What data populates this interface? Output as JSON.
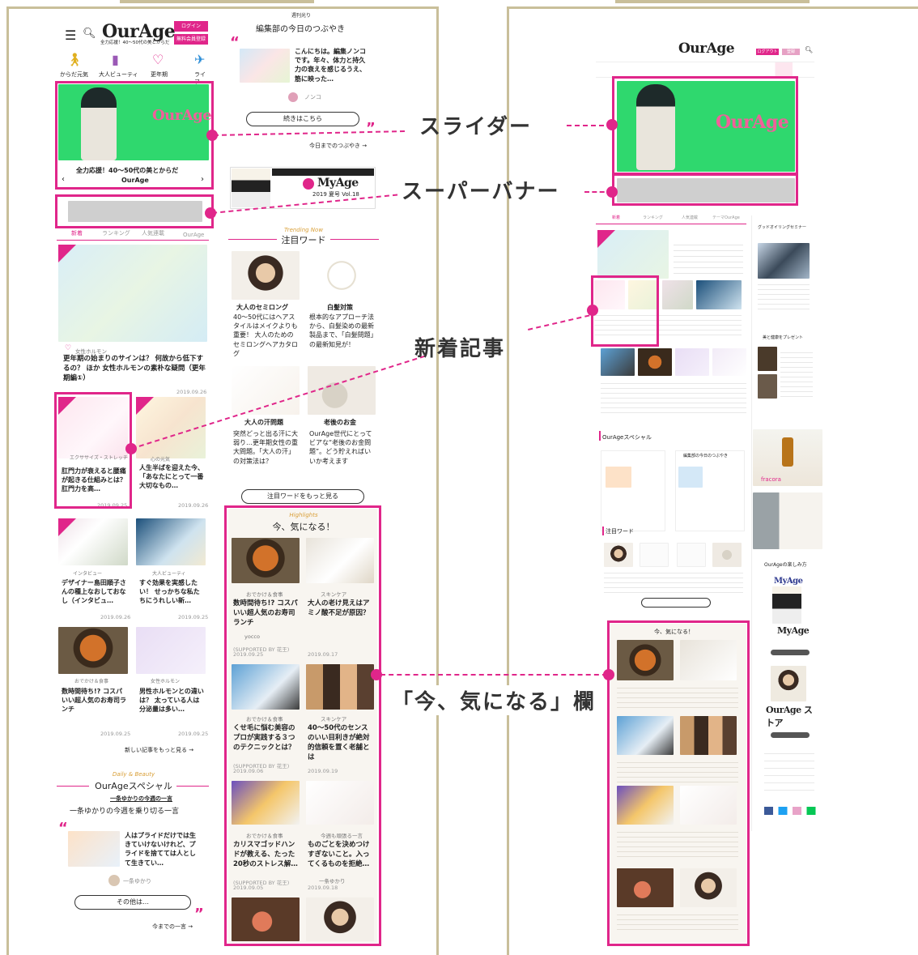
{
  "callouts": {
    "slider": "スライダー",
    "super_banner": "スーパーバナー",
    "new_articles": "新着記事",
    "ima_ki_ni_naru": "「今、気になる」欄"
  },
  "mobile": {
    "logo": "OurAge",
    "tagline": "全力応援！40〜50代の美とからだ",
    "login": "ログイン",
    "register": "無料会員登録",
    "categories": [
      {
        "label": "からだ元気",
        "icon": "figure-icon"
      },
      {
        "label": "大人ビューティ",
        "icon": "lipstick-icon"
      },
      {
        "label": "更年期",
        "icon": "heart-icon"
      },
      {
        "label": "ライフ",
        "icon": "paper-plane-icon"
      }
    ],
    "slider_logo": "OurAge",
    "slider_caption_1": "全力応援！40〜50代の美とからだ",
    "slider_caption_2": "OurAge",
    "tabs": [
      "新着",
      "ランキング",
      "人気連載",
      "OurAge"
    ],
    "articles": [
      {
        "cat": "女性ホルモン",
        "title": "更年期の始まりのサインは？ 何故から低下するの？ ほか 女性ホルモンの素朴な疑問（更年期編①）",
        "date": "2019.09.26"
      },
      {
        "cat": "エクササイズ・ストレッチ",
        "title": "肛門力が衰えると腰痛が起きる仕組みとは？ 肛門力を高…",
        "date": "2019.09.25"
      },
      {
        "cat": "心の元気",
        "title": "人生半ばを迎えた今、「あなたにとって一番大切なもの…",
        "date": "2019.09.26"
      },
      {
        "cat": "インタビュー",
        "title": "デザイナー島田順子さんの種上なおしておなし（インタビュ…",
        "date": "2019.09.26"
      },
      {
        "cat": "大人ビューティ",
        "title": "すぐ効果を実感したい！ せっかちな私たちにうれしい新…",
        "date": "2019.09.25"
      },
      {
        "cat": "おでかけ＆食事",
        "title": "数時間待ち!? コスパいい超人気のお寿司ランチ",
        "date": "2019.09.25"
      },
      {
        "cat": "女性ホルモン",
        "title": "男性ホルモンとの違いは？ 太っている人は分泌量は多い…",
        "date": "2019.09.25"
      }
    ],
    "more_articles": "新しい記事をもっと見る →",
    "special_sub": "Daily & Beauty",
    "special_title": "OurAgeスペシャル",
    "special_label": "一条ゆかりの今週の一言",
    "special_heading": "一条ゆかりの今週を乗り切る一言",
    "special_quote": "人はプライドだけでは生きていけないけれど、プライドを捨てては人として生きてい…",
    "special_author": "一条ゆかり",
    "special_button": "その他は…",
    "special_more": "今までの一言 →"
  },
  "mobile2": {
    "tsubuyaki_label": "週刊光り",
    "tsubuyaki_title": "編集部の今日のつぶやき",
    "tsubuyaki_text": "こんにちは。編集ノンコです。年々、体力と持久力の衰えを感じるうえ、筋に映った…",
    "tsubuyaki_author": "ノンコ",
    "tsubuyaki_button": "続きはこちら",
    "tsubuyaki_more": "今日までのつぶやき →",
    "myage_logo": "MyAge",
    "myage_issue": "2019 夏号 Vol.18",
    "trending_sub": "Trending Now",
    "trending_title": "注目ワード",
    "words": [
      {
        "title": "大人のセミロング",
        "desc": "40〜50代にはヘアスタイルはメイクよりも重要！ 大人のためのセミロングヘアカタログ"
      },
      {
        "title": "白髪対策",
        "desc": "根本的なアプローチ法から、白髪染めの最新製品まで、「白髪問題」の最新知見が！"
      },
      {
        "title": "大人の汗問題",
        "desc": "突然どっと出る汗に大弱り…更年期女性の重大問題。「大人の汗」の対策法は？"
      },
      {
        "title": "老後のお金",
        "desc": "OurAge世代にとってビアな“老後のお金問題”。どう貯えればいいか考えます"
      }
    ],
    "words_button": "注目ワードをもっと見る",
    "highlights_sub": "Highlights",
    "highlights_title": "今、気になる！",
    "highlights": [
      {
        "cat": "おでかけ＆食事",
        "title": "数時間待ち!? コスパいい超人気のお寿司ランチ",
        "author": "yocco",
        "meta": "(SUPPORTED BY 花王)",
        "date": "2019.09.25"
      },
      {
        "cat": "スキンケア",
        "title": "大人の老け見えはアミノ酸不足が原因？",
        "author": "",
        "meta": "",
        "date": "2019.09.17"
      },
      {
        "cat": "おでかけ＆食事",
        "title": "くせ毛に悩む美容のプロが実践する３つのテクニックとは？",
        "author": "",
        "meta": "(SUPPORTED BY 花王)",
        "date": "2019.09.06"
      },
      {
        "cat": "スキンケア",
        "title": "40〜50代のセンスのいい目利きが絶対的信頼を置く老舗とは",
        "author": "",
        "meta": "",
        "date": "2019.09.19"
      },
      {
        "cat": "おでかけ＆食事",
        "title": "カリスマゴッドハンドが教える、たった20秒のストレス解…",
        "author": "",
        "meta": "(SUPPORTED BY 花王)",
        "date": "2019.09.05"
      },
      {
        "cat": "今週も頑張る一言",
        "title": "ものごとを決めつけすぎないこと。入ってくるものを拒絶…",
        "author": "一条ゆかり",
        "meta": "",
        "date": "2019.09.18"
      }
    ]
  },
  "desktop": {
    "logo": "OurAge",
    "nav": [
      "ログアウト",
      "登録"
    ],
    "slider_logo": "OurAge",
    "tabs": [
      "新着",
      "ランキング",
      "人気連載",
      "テーマOurAge"
    ],
    "special_title": "OurAgeスペシャル",
    "tsubuyaki_title": "編集部の今日のつぶやき",
    "trending_title": "注目ワード",
    "highlights_title": "今、気になる！",
    "side_seminar": "グッドオイリングセミナー",
    "side_present": "美と健康をプレゼント",
    "side_brand": "fracora",
    "side_myage": "MyAge",
    "side_store": "OurAge ストア",
    "side_tanoshimikata": "OurAgeの楽しみ方"
  }
}
